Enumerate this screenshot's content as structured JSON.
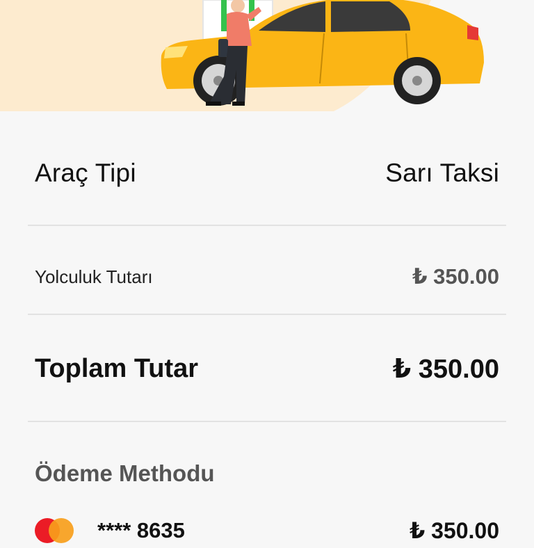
{
  "summary": {
    "vehicle_type_label": "Araç Tipi",
    "vehicle_type_value": "Sarı Taksi",
    "ride_fare_label": "Yolculuk Tutarı",
    "ride_fare_value": "₺ 350.00",
    "total_label": "Toplam Tutar",
    "total_value": "₺ 350.00"
  },
  "payment": {
    "title": "Ödeme Methodu",
    "card_brand_icon": "mastercard-icon",
    "card_number": "**** 8635",
    "amount": "₺ 350.00"
  },
  "illustration": {
    "name": "taxi-illustration",
    "colors": {
      "hero_background": "#fdebcf",
      "taxi_yellow": "#fbb515",
      "shirt": "#f07c68",
      "building_green": "#35c24d"
    }
  }
}
